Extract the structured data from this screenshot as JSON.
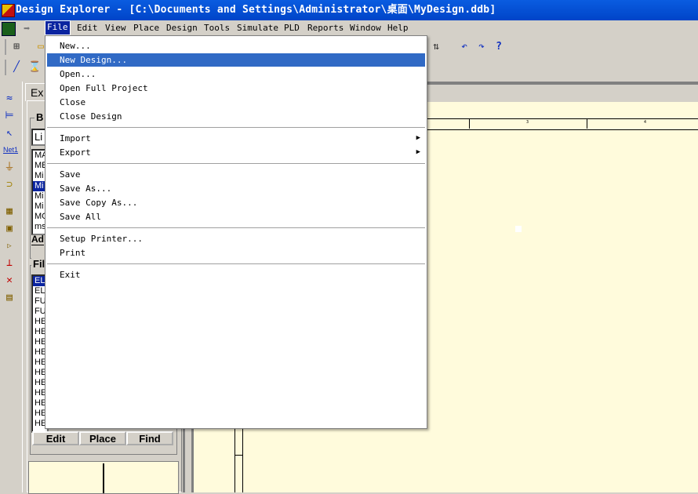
{
  "window": {
    "title": "Design Explorer - [C:\\Documents and Settings\\Administrator\\桌面\\MyDesign.ddb]"
  },
  "menubar": {
    "items": [
      "File",
      "Edit",
      "View",
      "Place",
      "Design",
      "Tools",
      "Simulate",
      "PLD",
      "Reports",
      "Window",
      "Help"
    ],
    "active": "File"
  },
  "file_menu": {
    "groups": [
      [
        {
          "label": "New...",
          "highlighted": false
        },
        {
          "label": "New Design...",
          "highlighted": true
        },
        {
          "label": "Open...",
          "highlighted": false
        },
        {
          "label": "Open Full Project",
          "highlighted": false
        },
        {
          "label": "Close",
          "highlighted": false
        },
        {
          "label": "Close Design",
          "highlighted": false
        }
      ],
      [
        {
          "label": "Import",
          "submenu": true
        },
        {
          "label": "Export",
          "submenu": true
        }
      ],
      [
        {
          "label": "Save"
        },
        {
          "label": "Save As..."
        },
        {
          "label": "Save Copy As..."
        },
        {
          "label": "Save All"
        }
      ],
      [
        {
          "label": "Setup Printer..."
        },
        {
          "label": "Print"
        }
      ],
      [
        {
          "label": "Exit"
        }
      ]
    ]
  },
  "explorer": {
    "tab": "Ex",
    "browse_title": "B",
    "browse_type": "Li",
    "libraries": [
      "MA",
      "ME",
      "Mi",
      "Mi",
      "Mi",
      "Mi",
      "MC",
      "ms"
    ],
    "selected_library_index": 3,
    "add_button": "Ad",
    "filter_title": "Fil",
    "parts": [
      "EL",
      "EL",
      "FU",
      "FU",
      "HE",
      "HE",
      "HE",
      "HE",
      "HE",
      "HE",
      "HE",
      "HE",
      "HE",
      "HE",
      "HE"
    ],
    "selected_part_index": 0,
    "buttons": {
      "edit": "Edit",
      "place": "Place",
      "find": "Find"
    }
  },
  "left_toolbar": {
    "netlabel": "Net1"
  },
  "sheet": {
    "ruler_labels": [
      "3",
      "4"
    ]
  },
  "colors": {
    "title_bar": "#0a5ce0",
    "menu_highlight": "#316ac5",
    "sheet_bg": "#fffbdc",
    "selection": "#0a24a0"
  }
}
